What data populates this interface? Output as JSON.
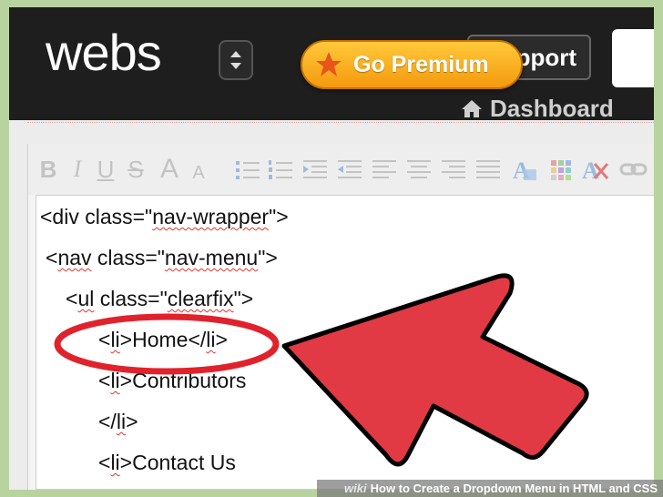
{
  "header": {
    "logo_text": "webs",
    "support_label": "pport",
    "premium_label": "Go Premium",
    "dashboard_label": "Dashboard"
  },
  "toolbar": {
    "items": [
      "B",
      "I",
      "U",
      "S",
      "A",
      "A"
    ]
  },
  "code_lines": [
    {
      "pre": "<div class=\"",
      "w1": "nav-wrapper",
      "post": "\">"
    },
    {
      "pre": "<",
      "w1": "nav",
      "mid": " class=\"",
      "w2": "nav-menu",
      "post": "\">"
    },
    {
      "pre": "<",
      "w1": "ul",
      "mid": " class=\"",
      "w2": "clearfix",
      "post": "\">"
    },
    {
      "pre": "<",
      "w1": "li",
      "mid": ">Home</",
      "w2": "li",
      "post": ">"
    },
    {
      "pre": "<",
      "w1": "li",
      "mid": ">Contributors",
      "w2": "",
      "post": ""
    },
    {
      "pre": "</",
      "w1": "li",
      "mid": ">",
      "w2": "",
      "post": ""
    },
    {
      "pre": "<",
      "w1": "li",
      "mid": ">Contact Us",
      "w2": "",
      "post": ""
    }
  ],
  "colors": {
    "header_bg": "#1e1e1e",
    "premium_orange": "#f7a516",
    "arrow_red": "#e23a44",
    "circle_red": "#e0222c"
  },
  "footer": {
    "wiki": "wiki",
    "caption": "How to Create a Dropdown Menu in HTML and CSS"
  }
}
